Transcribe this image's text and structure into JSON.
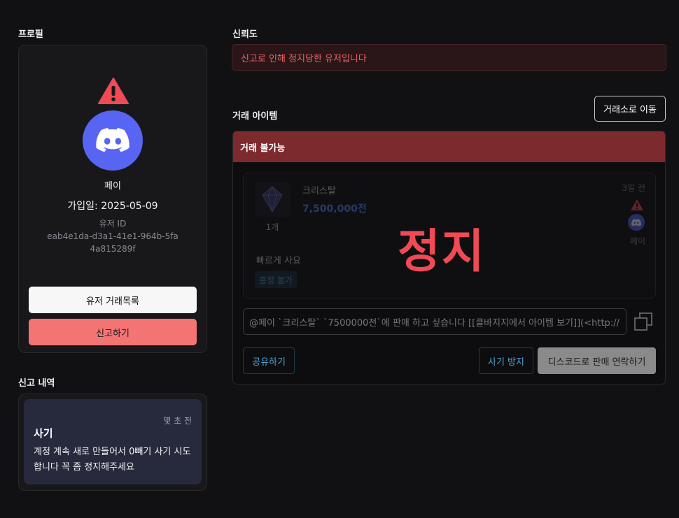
{
  "profile": {
    "section_title": "프로필",
    "nickname": "페이",
    "joined": "가입일: 2025-05-09",
    "user_id_label": "유저 ID",
    "user_id": "eab4e1da-d3a1-41e1-964b-5fa4a815289f",
    "trade_list_button": "유저 거래목록",
    "report_button": "신고하기"
  },
  "reports": {
    "section_title": "신고 내역",
    "items": [
      {
        "time": "몇 초 전",
        "title": "사기",
        "body": "계정 계속 새로 만들어서 0빼기 사기 시도합니다 꼭 좀 정지해주세요"
      }
    ]
  },
  "trust": {
    "section_title": "신뢰도",
    "banned_message": "신고로 인해 정지당한 유저입니다"
  },
  "trade": {
    "section_title": "거래 아이템",
    "go_market_button": "거래소로 이동",
    "status_header": "거래 불가능",
    "stamp": "정지",
    "item": {
      "name": "크리스탈",
      "price": "7,500,000전",
      "quantity": "1개",
      "time": "3일 전",
      "seller": "페이",
      "description": "빠르게 사요",
      "tag": "흥정 불가"
    },
    "message": "@페이 `크리스탈` `7500000전`에 판매 하고 싶습니다 [[클바지지에서 아이템 보기]](<http://",
    "share_button": "공유하기",
    "fraud_button": "사기 방지",
    "discord_button": "디스코드로 판매 연락하기"
  },
  "colors": {
    "background": "#111113",
    "danger": "#f04a55",
    "discord": "#5865f2",
    "banner_header": "#7c2a2e",
    "link": "#4fa3d1",
    "price": "#4d8dff"
  }
}
